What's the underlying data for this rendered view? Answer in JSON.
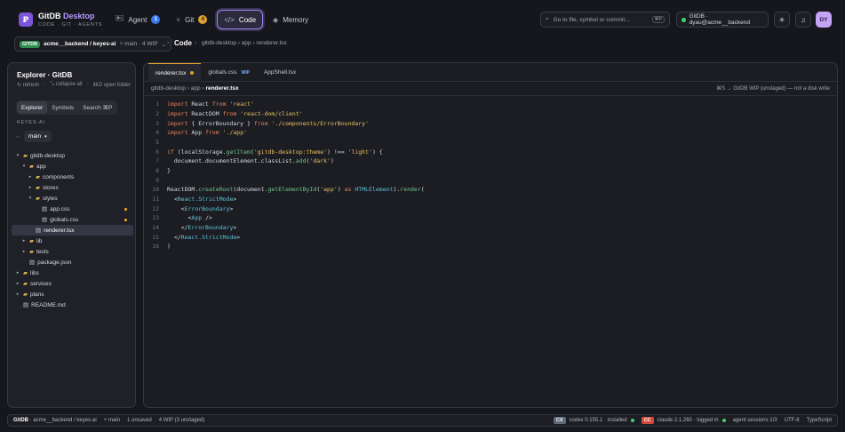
{
  "app": {
    "logo_letter": "Ꝑ",
    "brand_main": "GitDB",
    "brand_accent": "Desktop",
    "brand_sub": "CODE · GIT · AGENTS"
  },
  "nav": {
    "agent": {
      "label": "Agent",
      "badge": "1",
      "icon": "agent-icon"
    },
    "git": {
      "label": "Git",
      "badge": "4",
      "icon": "branch-icon"
    },
    "code": {
      "label": "Code",
      "icon": "code-icon"
    },
    "memory": {
      "label": "Memory",
      "icon": "layers-icon"
    }
  },
  "search": {
    "placeholder": "Go to file, symbol or commit…",
    "shortcut": "⌘P"
  },
  "user": {
    "label": "GitDB · dyau@acme__backend",
    "initials": "DY"
  },
  "crumbs": {
    "gitdb_tag": "GITDB",
    "repo": "acme__backend / keyes-ai",
    "branch_info": "⑂ main · 4 WIP",
    "section": "Code",
    "path": "gitdb-desktop › app › renderer.tsx"
  },
  "explorer": {
    "title": "Explorer · GitDB",
    "actions": [
      "↻ refresh",
      "⤡ collapse all",
      "⌘O open folder"
    ],
    "tabs": [
      "Explorer",
      "Symbols",
      "Search ⌘P"
    ],
    "workspace": "KEYES-AI",
    "branch": "main",
    "tree": [
      {
        "name": "gitdb-desktop",
        "type": "folder",
        "depth": 0,
        "open": true
      },
      {
        "name": "app",
        "type": "folder",
        "depth": 1,
        "open": true
      },
      {
        "name": "components",
        "type": "folder",
        "depth": 2,
        "open": false
      },
      {
        "name": "stores",
        "type": "folder",
        "depth": 2,
        "open": false
      },
      {
        "name": "styles",
        "type": "folder",
        "depth": 2,
        "open": true
      },
      {
        "name": "app.css",
        "type": "file",
        "depth": 3,
        "modified": true
      },
      {
        "name": "globals.css",
        "type": "file",
        "depth": 3,
        "modified": true
      },
      {
        "name": "renderer.tsx",
        "type": "file",
        "depth": 2,
        "selected": true
      },
      {
        "name": "lib",
        "type": "folder",
        "depth": 1,
        "open": false
      },
      {
        "name": "tests",
        "type": "folder",
        "depth": 1,
        "open": false
      },
      {
        "name": "package.json",
        "type": "file",
        "depth": 1
      },
      {
        "name": "libs",
        "type": "folder",
        "depth": 0,
        "open": false
      },
      {
        "name": "services",
        "type": "folder",
        "depth": 0,
        "open": false
      },
      {
        "name": "plans",
        "type": "folder",
        "depth": 0,
        "open": false
      },
      {
        "name": "README.md",
        "type": "file",
        "depth": 0
      }
    ]
  },
  "editor": {
    "tabs": [
      {
        "label": "renderer.tsx",
        "active": true,
        "dirty": true
      },
      {
        "label": "globals.css",
        "tag": "WIP"
      },
      {
        "label": "AppShell.tsx"
      }
    ],
    "path_prefix": "gitdb-desktop › app › ",
    "path_file": "renderer.tsx",
    "status": "⌘S → GitDB WIP (unstaged) — not a disk write",
    "lines": [
      [
        [
          "k",
          "import"
        ],
        [
          "p",
          " React "
        ],
        [
          "k",
          "from"
        ],
        [
          "p",
          " "
        ],
        [
          "s",
          "'react'"
        ]
      ],
      [
        [
          "k",
          "import"
        ],
        [
          "p",
          " ReactDOM "
        ],
        [
          "k",
          "from"
        ],
        [
          "p",
          " "
        ],
        [
          "s",
          "'react-dom/client'"
        ]
      ],
      [
        [
          "k",
          "import"
        ],
        [
          "p",
          " { ErrorBoundary } "
        ],
        [
          "k",
          "from"
        ],
        [
          "p",
          " "
        ],
        [
          "s",
          "'./components/ErrorBoundary'"
        ]
      ],
      [
        [
          "k",
          "import"
        ],
        [
          "p",
          " App "
        ],
        [
          "k",
          "from"
        ],
        [
          "p",
          " "
        ],
        [
          "s",
          "'./app'"
        ]
      ],
      [],
      [
        [
          "k",
          "if"
        ],
        [
          "p",
          " (localStorage."
        ],
        [
          "f",
          "getItem"
        ],
        [
          "p",
          "("
        ],
        [
          "s",
          "'gitdb-desktop:theme'"
        ],
        [
          "p",
          ") !== "
        ],
        [
          "s",
          "'light'"
        ],
        [
          "p",
          ") {"
        ]
      ],
      [
        [
          "p",
          "  document.documentElement.classList."
        ],
        [
          "f",
          "add"
        ],
        [
          "p",
          "("
        ],
        [
          "s",
          "'dark'"
        ],
        [
          "p",
          ")"
        ]
      ],
      [
        [
          "p",
          "}"
        ]
      ],
      [],
      [
        [
          "p",
          "ReactDOM."
        ],
        [
          "f",
          "createRoot"
        ],
        [
          "p",
          "(document."
        ],
        [
          "f",
          "getElementById"
        ],
        [
          "p",
          "("
        ],
        [
          "s",
          "'app'"
        ],
        [
          "p",
          ") "
        ],
        [
          "k",
          "as"
        ],
        [
          "p",
          " "
        ],
        [
          "t",
          "HTMLElement"
        ],
        [
          "p",
          ")."
        ],
        [
          "f",
          "render"
        ],
        [
          "p",
          "("
        ]
      ],
      [
        [
          "p",
          "  <"
        ],
        [
          "t",
          "React.StrictMode"
        ],
        [
          "p",
          ">"
        ]
      ],
      [
        [
          "p",
          "    <"
        ],
        [
          "t",
          "ErrorBoundary"
        ],
        [
          "p",
          ">"
        ]
      ],
      [
        [
          "p",
          "      <"
        ],
        [
          "t",
          "App"
        ],
        [
          "p",
          " />"
        ]
      ],
      [
        [
          "p",
          "    </"
        ],
        [
          "t",
          "ErrorBoundary"
        ],
        [
          "p",
          ">"
        ]
      ],
      [
        [
          "p",
          "  </"
        ],
        [
          "t",
          "React.StrictMode"
        ],
        [
          "p",
          ">"
        ]
      ],
      [
        [
          "p",
          ")"
        ]
      ]
    ]
  },
  "statusbar": {
    "brand": "GitDB",
    "repo": "· acme__backend / keyes-ai",
    "branch": "⑂ main",
    "unsaved": "1 unsaved",
    "wip": "4 WIP (3 unstaged)",
    "codex_tag": "CX",
    "codex": "codex 0.155.1 · installed",
    "claude_tag": "CC",
    "claude": "claude 2.1.260 · logged in",
    "sessions": "agent sessions 1/3",
    "encoding": "UTF-8",
    "language": "TypeScript"
  },
  "colors": {
    "accent": "#9b86f0",
    "wip": "#e0a22c",
    "ok": "#3dd36b"
  }
}
